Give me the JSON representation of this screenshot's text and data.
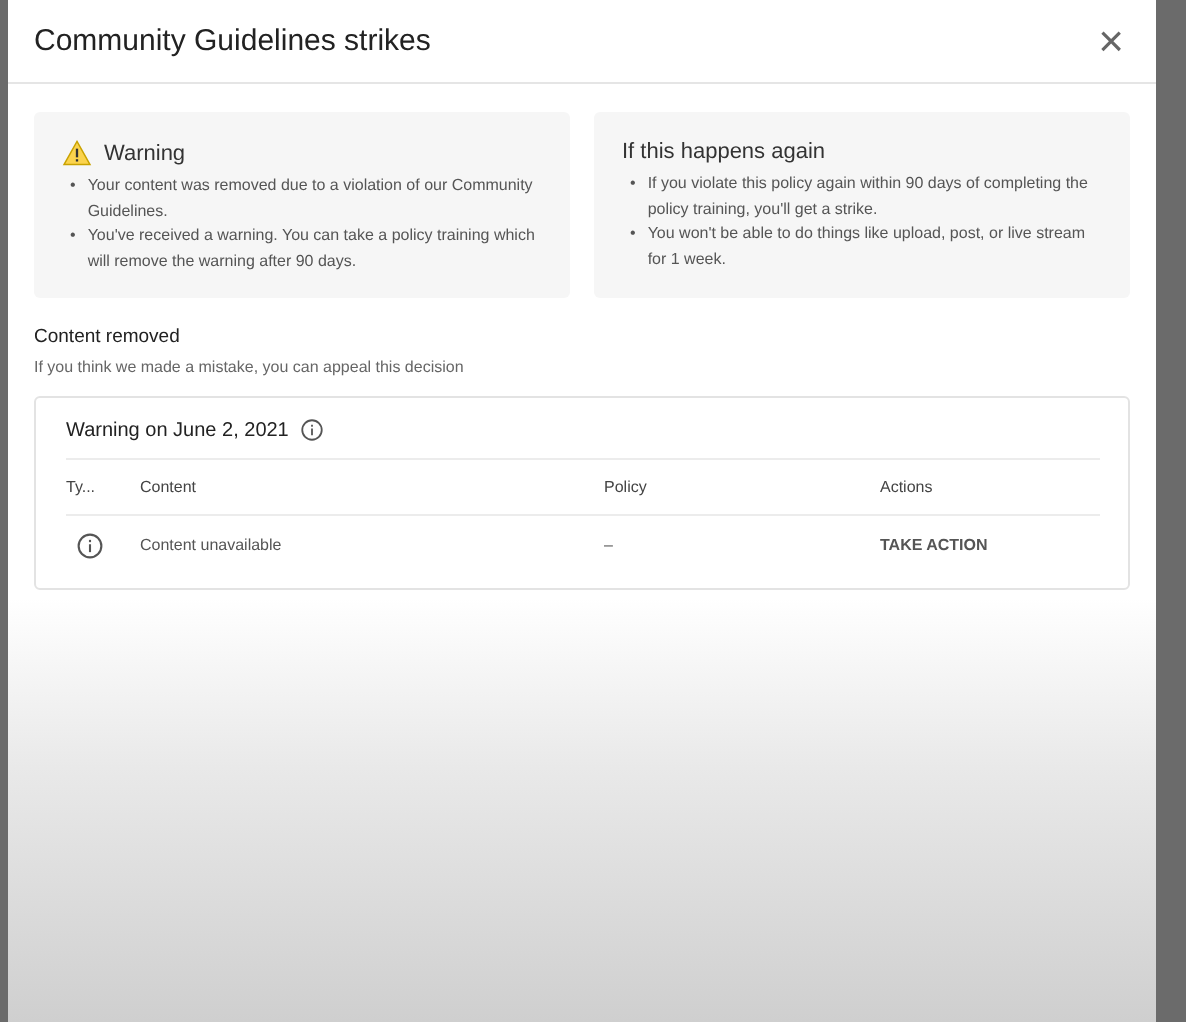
{
  "dialog": {
    "title": "Community Guidelines strikes",
    "close": "×"
  },
  "info_cards": [
    {
      "kind": "warning",
      "title": "Warning",
      "marker": "•",
      "bullets": [
        "Your content was removed due to a violation of our Community Guidelines.",
        "You've received a warning. You can take a policy training which will remove the warning after 90 days."
      ]
    },
    {
      "kind": "plain",
      "title": "If this happens again",
      "marker": "•",
      "bullets": [
        "If you violate this policy again within 90 days of completing the policy training, you'll get a strike.",
        "You won't be able to do things like upload, post, or live stream for 1 week."
      ]
    }
  ],
  "section": {
    "title": "Content removed",
    "subtitle": "If you think we made a mistake, you can appeal this decision"
  },
  "strike": {
    "title": "Warning on June 2, 2021",
    "columns": [
      "Ty...",
      "Content",
      "Policy",
      "Actions"
    ],
    "rows": [
      {
        "content": "Content unavailable",
        "policy": "–",
        "action": "TAKE ACTION"
      }
    ]
  }
}
